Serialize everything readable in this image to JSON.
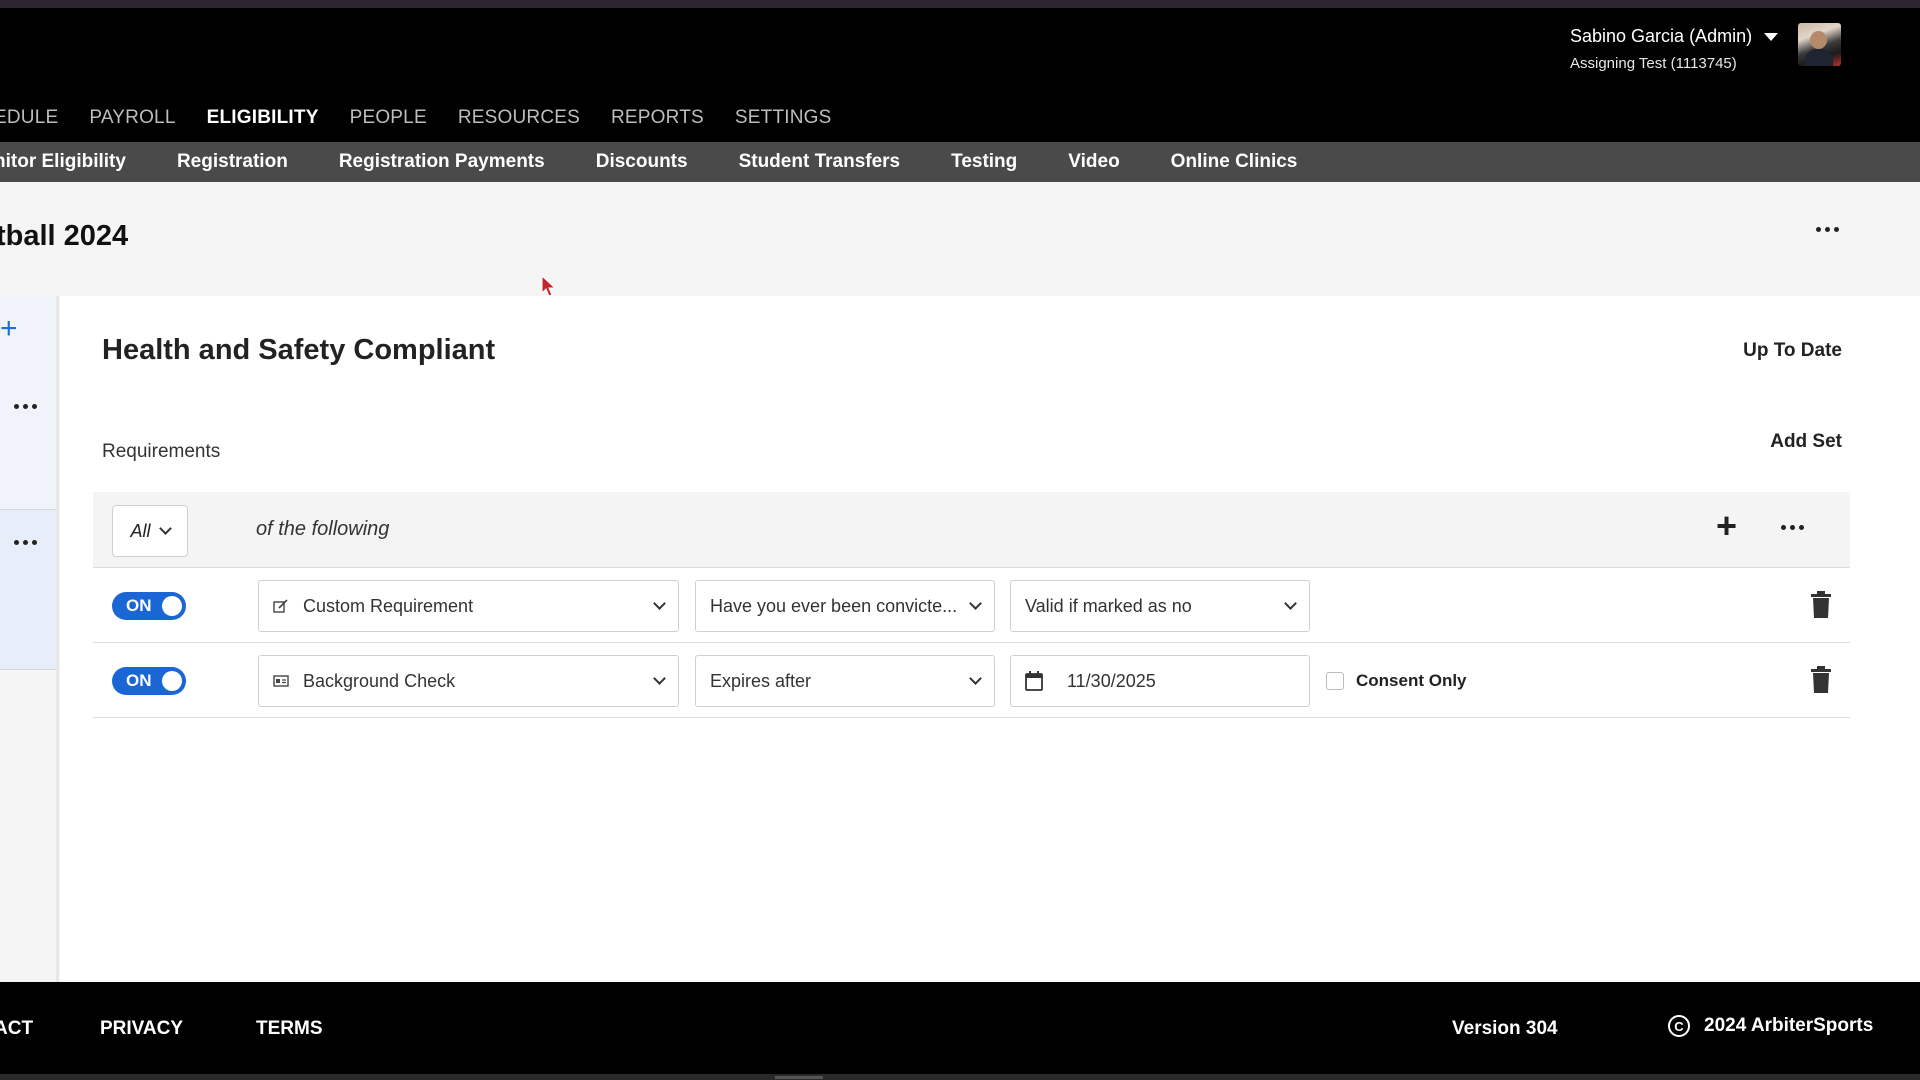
{
  "header": {
    "user_name": "Sabino Garcia (Admin)",
    "user_org": "Assigning Test (1113745)"
  },
  "main_nav": {
    "items": [
      "EDULE",
      "PAYROLL",
      "ELIGIBILITY",
      "PEOPLE",
      "RESOURCES",
      "REPORTS",
      "SETTINGS"
    ],
    "active": "ELIGIBILITY"
  },
  "sub_nav": {
    "items": [
      "nitor Eligibility",
      "Registration",
      "Registration Payments",
      "Discounts",
      "Student Transfers",
      "Testing",
      "Video",
      "Online Clinics"
    ]
  },
  "page": {
    "title": "tball 2024"
  },
  "card": {
    "title": "Health and Safety Compliant",
    "status": "Up To Date",
    "requirements_label": "Requirements",
    "add_set_label": "Add Set",
    "match_select": "All",
    "match_suffix": "of the following",
    "rows": [
      {
        "toggle": "ON",
        "type": "Custom Requirement",
        "type_icon": "edit-icon",
        "condition": "Have you ever been convicte...",
        "value": "Valid if marked as no"
      },
      {
        "toggle": "ON",
        "type": "Background Check",
        "type_icon": "id-card-icon",
        "condition": "Expires after",
        "date": "11/30/2025",
        "consent_label": "Consent Only",
        "consent_checked": false
      }
    ]
  },
  "footer": {
    "links": [
      "ACT",
      "PRIVACY",
      "TERMS"
    ],
    "version": "Version 304",
    "copyright": "2024 ArbiterSports"
  },
  "colors": {
    "accent": "#1a66d4",
    "header_bg": "#000000",
    "subnav_bg": "#4a4a4a"
  }
}
